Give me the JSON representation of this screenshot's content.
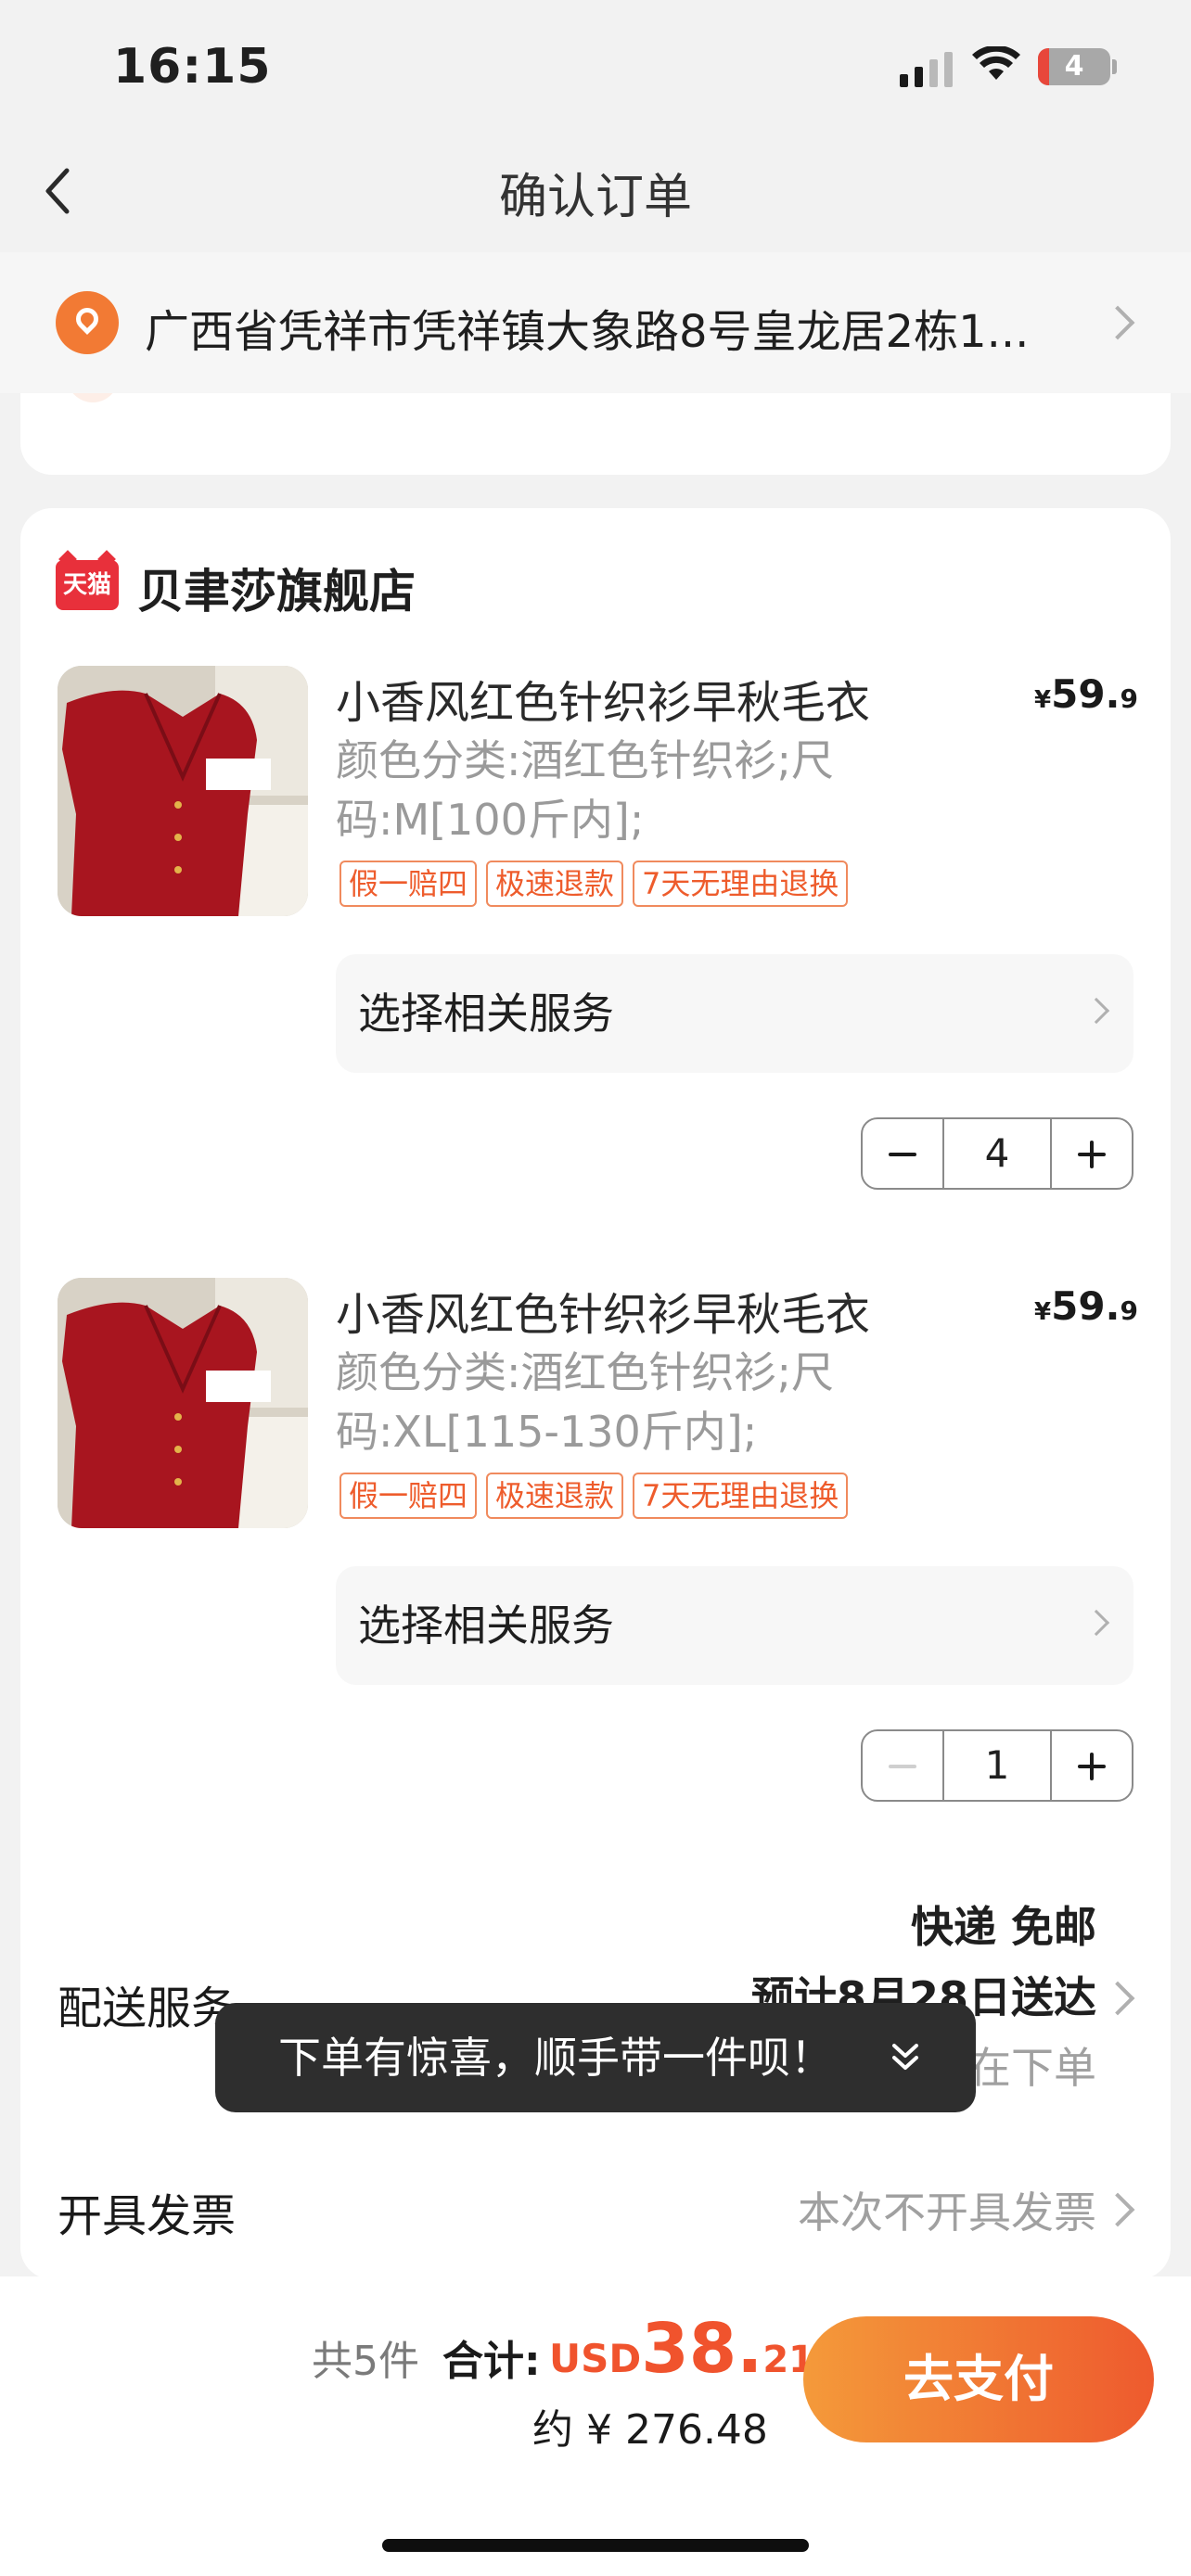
{
  "status_bar": {
    "time": "16:15",
    "battery": "4"
  },
  "nav": {
    "title": "确认订单"
  },
  "address": {
    "text": "广西省凭祥市凭祥镇大象路8号皇龙居2栋1..."
  },
  "store": {
    "badge": "天猫",
    "name": "贝聿莎旗舰店",
    "items": [
      {
        "name": "小香风红色针织衫早秋毛衣",
        "price_symbol": "¥",
        "price_int": "59.",
        "price_dec": "9",
        "spec": "颜色分类:酒红色针织衫;尺码:M[100斤内];",
        "tags": [
          "假一赔四",
          "极速退款",
          "7天无理由退换"
        ],
        "service": "选择相关服务",
        "quantity": "4"
      },
      {
        "name": "小香风红色针织衫早秋毛衣",
        "price_symbol": "¥",
        "price_int": "59.",
        "price_dec": "9",
        "spec": "颜色分类:酒红色针织衫;尺码:XL[115-130斤内];",
        "tags": [
          "假一赔四",
          "极速退款",
          "7天无理由退换"
        ],
        "service": "选择相关服务",
        "quantity": "1"
      }
    ]
  },
  "delivery": {
    "label": "配送服务",
    "line1": "快递 免邮",
    "line2": "预计8月28日送达",
    "line3": "在下单"
  },
  "toast": {
    "text": "下单有惊喜，顺手带一件呗！"
  },
  "invoice": {
    "label": "开具发票",
    "value": "本次不开具发票"
  },
  "footer": {
    "count": "共5件",
    "total_label": "合计:",
    "currency": "USD",
    "amount_int": "38.",
    "amount_dec": "21",
    "approx": "约 ¥ 276.48",
    "pay_button": "去支付"
  },
  "colors": {
    "accent": "#ee5a2e",
    "tmall": "#e8303b"
  }
}
